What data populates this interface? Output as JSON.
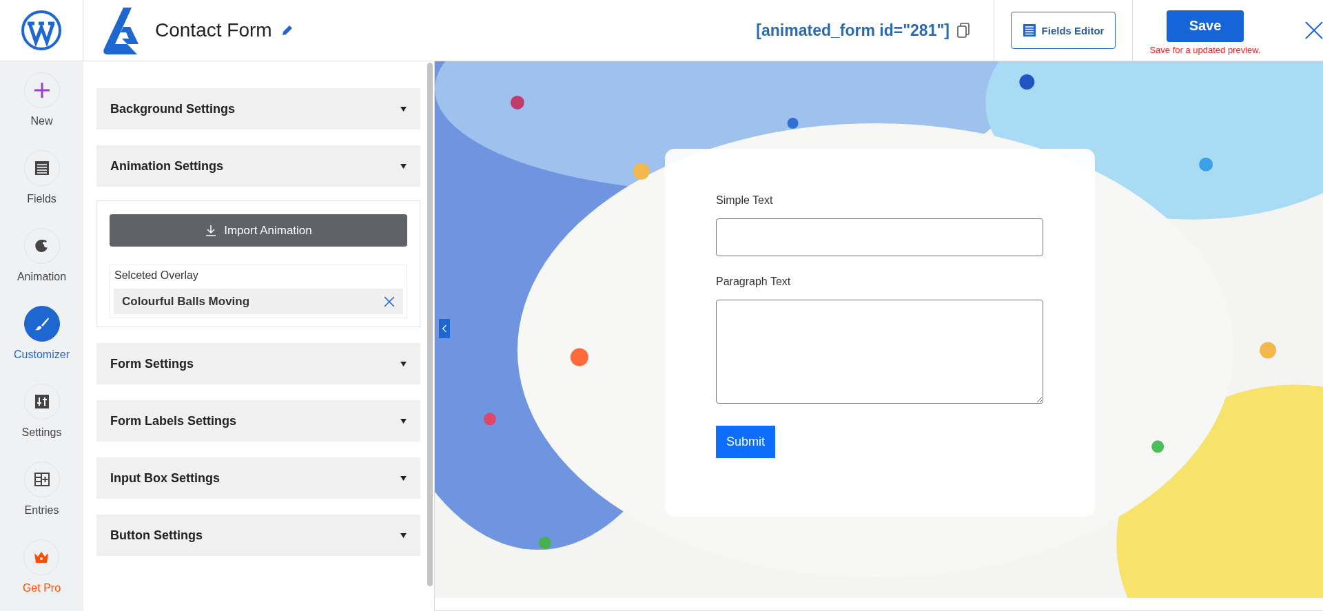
{
  "header": {
    "title": "Contact Form",
    "shortcode": "[animated_form id=\"281\"]",
    "fields_editor": "Fields Editor",
    "save": "Save",
    "save_hint": "Save for a updated preview."
  },
  "nav": [
    {
      "label": "New",
      "kind": "new",
      "selected": false
    },
    {
      "label": "Fields",
      "kind": "fields",
      "selected": false
    },
    {
      "label": "Animation",
      "kind": "animation",
      "selected": false
    },
    {
      "label": "Customizer",
      "kind": "customizer",
      "selected": true
    },
    {
      "label": "Settings",
      "kind": "settings",
      "selected": false
    },
    {
      "label": "Entries",
      "kind": "entries",
      "selected": false
    },
    {
      "label": "Get Pro",
      "kind": "pro",
      "selected": false
    }
  ],
  "sections": [
    {
      "title": "Background Settings"
    },
    {
      "title": "Animation Settings",
      "import_button": "Import Animation",
      "overlay_label": "Selceted Overlay",
      "overlay": "Colourful Balls Moving"
    },
    {
      "title": "Form Settings"
    },
    {
      "title": "Form Labels Settings"
    },
    {
      "title": "Input Box Settings"
    },
    {
      "title": "Button Settings"
    }
  ],
  "preview": {
    "fields": [
      {
        "label": "Simple Text",
        "kind": "text"
      },
      {
        "label": "Paragraph Text",
        "kind": "textarea"
      }
    ],
    "submit": "Submit"
  }
}
